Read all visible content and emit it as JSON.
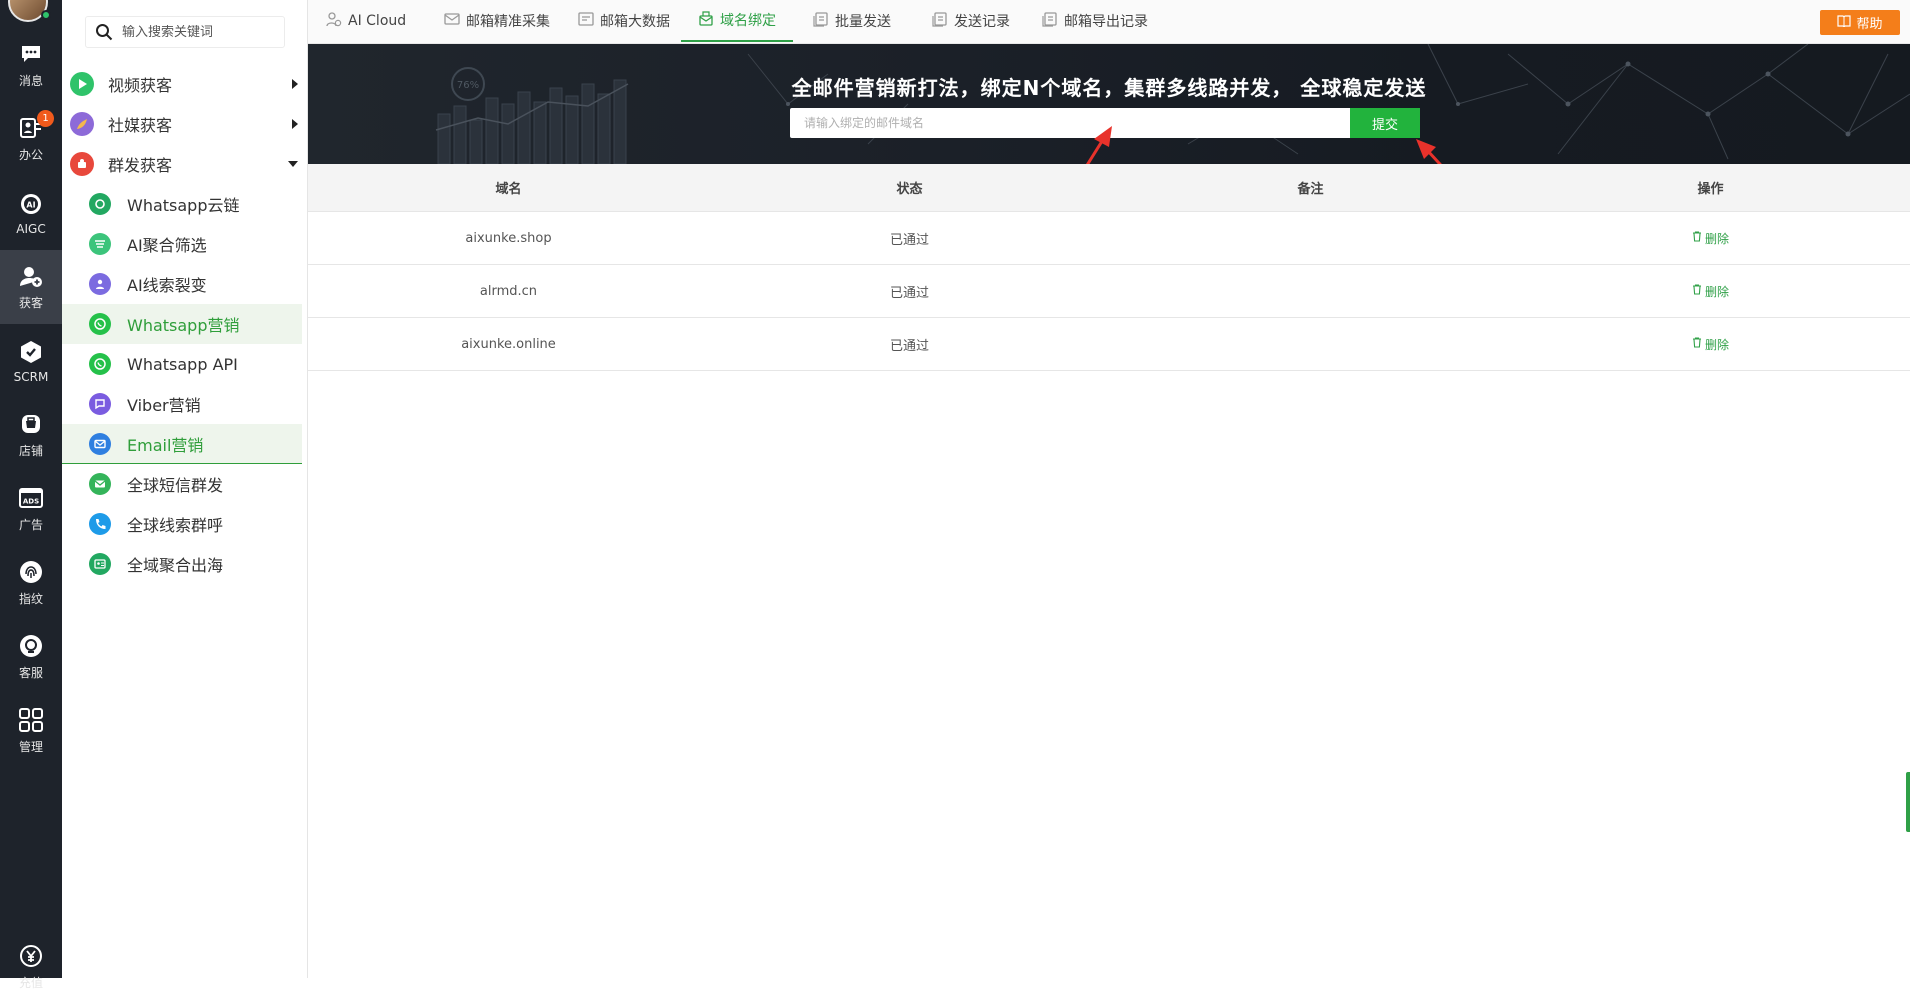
{
  "rail": {
    "items": [
      {
        "label": "消息",
        "icon": "chat-icon"
      },
      {
        "label": "办公",
        "icon": "office-icon",
        "badge": "1"
      },
      {
        "label": "AIGC",
        "icon": "ai-icon"
      },
      {
        "label": "获客",
        "icon": "user-add-icon",
        "active": true
      },
      {
        "label": "SCRM",
        "icon": "scrm-icon"
      },
      {
        "label": "店铺",
        "icon": "store-icon"
      },
      {
        "label": "广告",
        "icon": "ads-icon"
      },
      {
        "label": "指纹",
        "icon": "fingerprint-icon"
      },
      {
        "label": "客服",
        "icon": "service-icon"
      },
      {
        "label": "管理",
        "icon": "grid-icon"
      },
      {
        "label": "充值",
        "icon": "yen-icon"
      }
    ]
  },
  "sidebar": {
    "search_placeholder": "输入搜索关键词",
    "groups": [
      {
        "label": "视频获客",
        "color": "#2fc36a"
      },
      {
        "label": "社媒获客",
        "color": "#8d6ad8"
      },
      {
        "label": "群发获客",
        "color": "#e8483c"
      }
    ],
    "items": [
      {
        "label": "Whatsapp云链",
        "color": "#22a861"
      },
      {
        "label": "AI聚合筛选",
        "color": "#3cc47b"
      },
      {
        "label": "AI线索裂变",
        "color": "#7b6be0"
      },
      {
        "label": "Whatsapp营销",
        "color": "#25c14a"
      },
      {
        "label": "Whatsapp API",
        "color": "#25c14a"
      },
      {
        "label": "Viber营销",
        "color": "#7a5ce0"
      },
      {
        "label": "Email营销",
        "color": "#2f7fe0"
      },
      {
        "label": "全球短信群发",
        "color": "#34b45a"
      },
      {
        "label": "全球线索群呼",
        "color": "#1e9be8"
      },
      {
        "label": "全域聚合出海",
        "color": "#22a861"
      }
    ]
  },
  "tabs": [
    {
      "label": "AI Cloud",
      "icon": "ai-cloud-icon"
    },
    {
      "label": "邮箱精准采集",
      "icon": "mail-collect-icon"
    },
    {
      "label": "邮箱大数据",
      "icon": "data-icon"
    },
    {
      "label": "域名绑定",
      "icon": "domain-icon"
    },
    {
      "label": "批量发送",
      "icon": "batch-send-icon"
    },
    {
      "label": "发送记录",
      "icon": "record-icon"
    },
    {
      "label": "邮箱导出记录",
      "icon": "export-icon"
    }
  ],
  "help_label": "帮助",
  "banner": {
    "title": "全邮件营销新打法，绑定N个域名，集群多线路并发， 全球稳定发送",
    "placeholder": "请输入绑定的邮件域名",
    "submit": "提交",
    "decor_text": "76%"
  },
  "table": {
    "columns": [
      "域名",
      "状态",
      "备注",
      "操作"
    ],
    "rows": [
      {
        "domain": "aixunke.shop",
        "status": "已通过",
        "note": "",
        "action": "删除"
      },
      {
        "domain": "alrmd.cn",
        "status": "已通过",
        "note": "",
        "action": "删除"
      },
      {
        "domain": "aixunke.online",
        "status": "已通过",
        "note": "",
        "action": "删除"
      }
    ]
  },
  "colors": {
    "accent": "#2fa047",
    "help": "#f47e1a",
    "rail_bg": "#1e232b",
    "annotation": "#e8322b"
  }
}
